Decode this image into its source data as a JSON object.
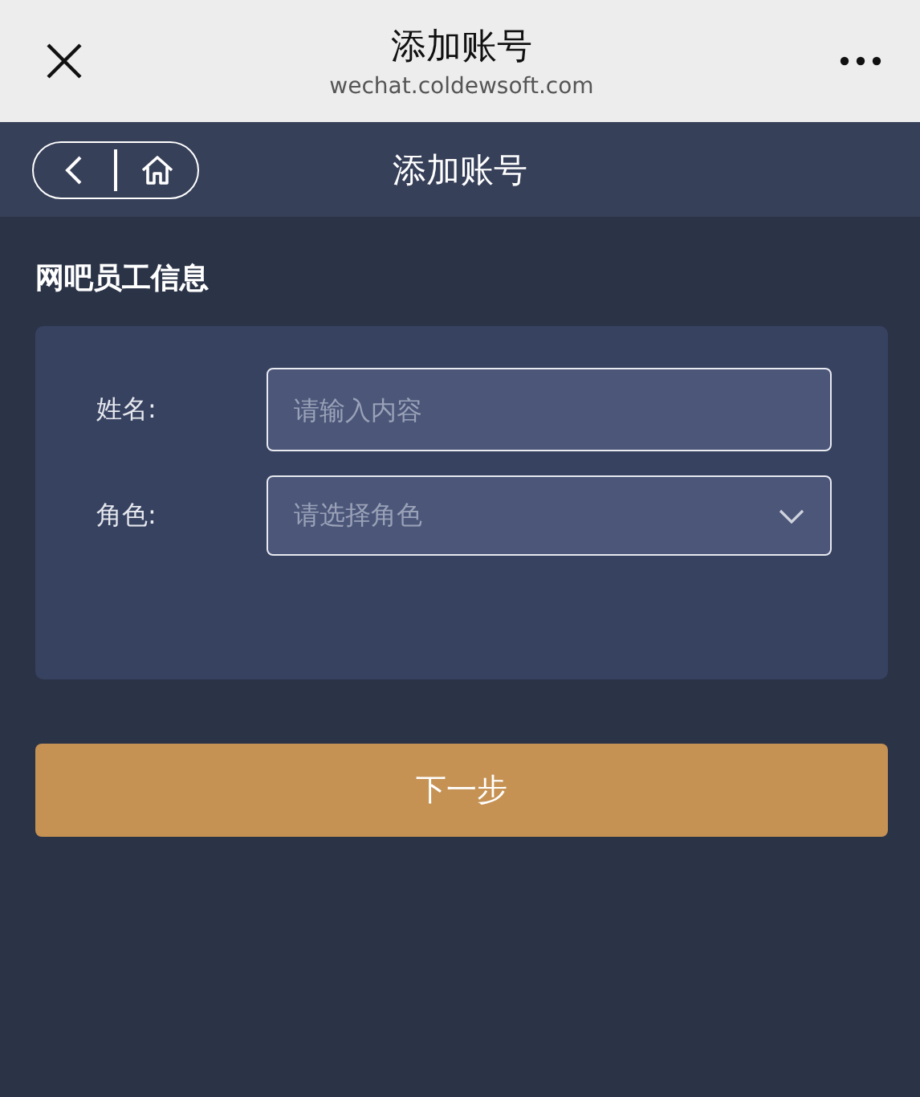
{
  "browser_bar": {
    "title": "添加账号",
    "url": "wechat.coldewsoft.com"
  },
  "nav": {
    "title": "添加账号"
  },
  "section_title": "网吧员工信息",
  "fields": [
    {
      "kind": "text",
      "label": "姓名:",
      "placeholder": "请输入内容"
    },
    {
      "kind": "select",
      "label": "角色:",
      "placeholder": "请选择角色"
    }
  ],
  "primary_button": "下一步"
}
